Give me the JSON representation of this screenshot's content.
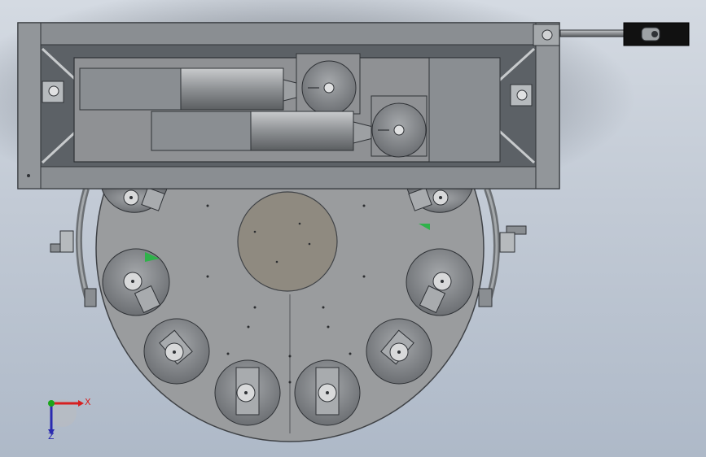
{
  "viewport": {
    "background_top": "#d4dae2",
    "background_bottom": "#aeb9c8"
  },
  "model_colors": {
    "steel": "#8a8e92",
    "steel_dark": "#5f6366",
    "steel_light": "#b6babd",
    "plate": "#9a9c9e",
    "cup": "#7d8084",
    "center_disc": "#8f8a80",
    "green_marker": "#2fb24a",
    "cylinder_block": "#111111"
  },
  "triad": {
    "x_label": "X",
    "y_label": "Y",
    "z_label": "Z",
    "x_color": "#d62020",
    "y_color": "#1aa61a",
    "z_color": "#2a2ab0"
  }
}
